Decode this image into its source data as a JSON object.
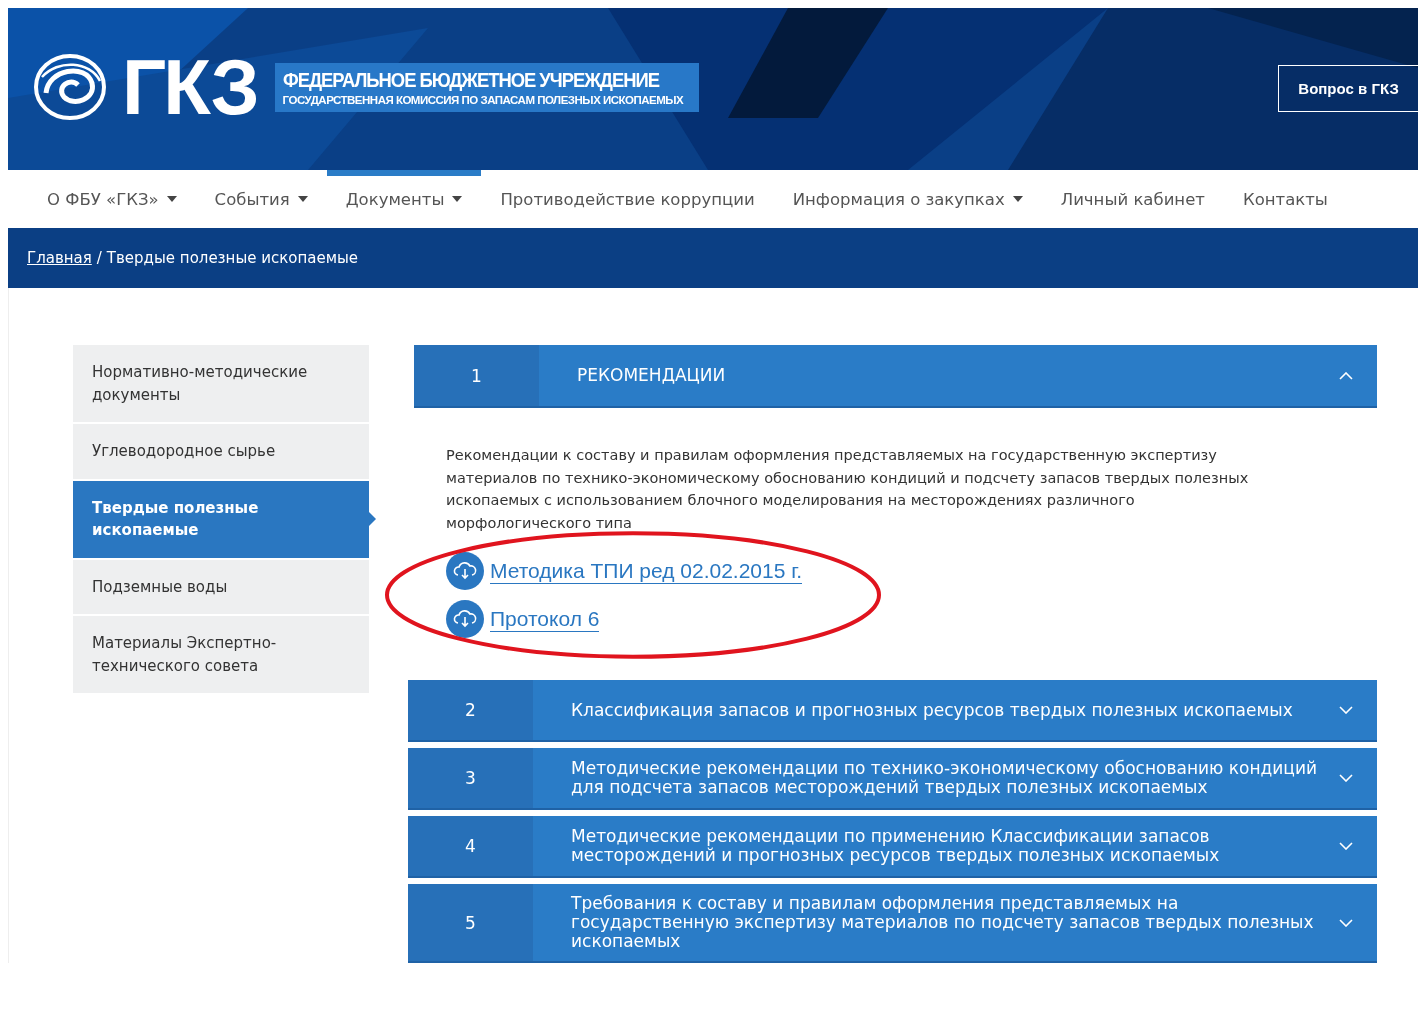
{
  "header": {
    "logo_text": "ГКЗ",
    "org_title": "ФЕДЕРАЛЬНОЕ БЮДЖЕТНОЕ УЧРЕЖДЕНИЕ",
    "org_subtitle": "ГОСУДАРСТВЕННАЯ КОМИССИЯ ПО ЗАПАСАМ ПОЛЕЗНЫХ ИСКОПАЕМЫХ",
    "question_button": "Вопрос в ГКЗ"
  },
  "nav": [
    {
      "label": "О ФБУ «ГКЗ»",
      "dropdown": true,
      "selected": false
    },
    {
      "label": "События",
      "dropdown": true,
      "selected": false
    },
    {
      "label": "Документы",
      "dropdown": true,
      "selected": true
    },
    {
      "label": "Противодействие коррупции",
      "dropdown": false,
      "selected": false
    },
    {
      "label": "Информация о закупках",
      "dropdown": true,
      "selected": false
    },
    {
      "label": "Личный кабинет",
      "dropdown": false,
      "selected": false
    },
    {
      "label": "Контакты",
      "dropdown": false,
      "selected": false
    }
  ],
  "breadcrumb": {
    "home": "Главная",
    "separator": "/",
    "current": "Твердые полезные ископаемые"
  },
  "sidebar": {
    "items": [
      {
        "label": "Нормативно-методические документы",
        "selected": false
      },
      {
        "label": "Углеводородное сырье",
        "selected": false
      },
      {
        "label": "Твердые полезные ископаемые",
        "selected": true
      },
      {
        "label": "Подземные воды",
        "selected": false
      },
      {
        "label": "Материалы Экспертно-технического совета",
        "selected": false
      }
    ]
  },
  "accordion": [
    {
      "number": "1",
      "title": "РЕКОМЕНДАЦИИ",
      "expanded": true,
      "description": "Рекомендации к составу и правилам оформления представляемых на государственную экспертизу материалов по технико-экономическому обоснованию кондиций и подсчету запасов твердых полезных ископаемых с использованием блочного моделирования на месторождениях различного морфологического типа",
      "files": [
        "Методика ТПИ ред 02.02.2015 г.",
        "Протокол 6"
      ]
    },
    {
      "number": "2",
      "title": "Классификация запасов и прогнозных ресурсов твердых полезных ископаемых",
      "expanded": false
    },
    {
      "number": "3",
      "title": "Методические рекомендации по технико-экономическому обоснованию кондиций для подсчета запасов месторождений твердых полезных ископаемых",
      "expanded": false
    },
    {
      "number": "4",
      "title": "Методические рекомендации по применению Классификации запасов месторождений и прогнозных ресурсов твердых полезных ископаемых",
      "expanded": false
    },
    {
      "number": "5",
      "title": "Требования к составу и правилам оформления представляемых на государственную экспертизу материалов по подсчету запасов твердых полезных ископаемых",
      "expanded": false
    }
  ]
}
